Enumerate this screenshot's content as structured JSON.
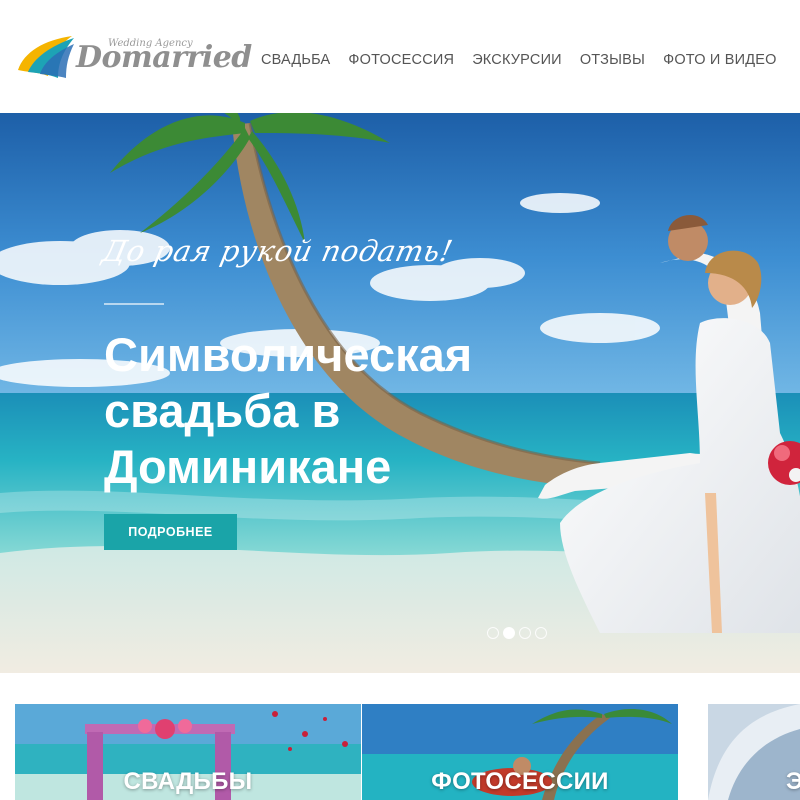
{
  "logo": {
    "tagline": "Wedding Agency",
    "name": "Domarried"
  },
  "nav": {
    "items": [
      {
        "label": "СВАДЬБА"
      },
      {
        "label": "ФОТОСЕССИЯ"
      },
      {
        "label": "ЭКСКУРСИИ"
      },
      {
        "label": "ОТЗЫВЫ"
      },
      {
        "label": "ФОТО И ВИДЕО"
      }
    ]
  },
  "hero": {
    "tagline": "До рая рукой подать!",
    "title_lines": [
      "Символическая",
      "свадьба в",
      "Доминикане"
    ],
    "button_label": "ПОДРОБНЕЕ",
    "slide_count": 4,
    "active_slide": 2
  },
  "cards": [
    {
      "label": "СВАДЬБЫ"
    },
    {
      "label": "ФОТОСЕССИИ"
    },
    {
      "label": "Э"
    }
  ],
  "colors": {
    "accent": "#1aa4a8",
    "nav_text": "#555555",
    "logo_text": "#8f8f8f"
  }
}
